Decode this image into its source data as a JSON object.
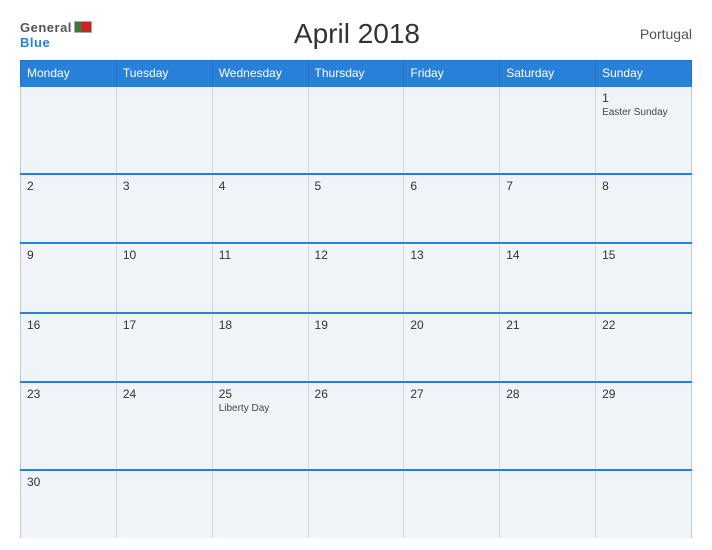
{
  "header": {
    "logo_general": "General",
    "logo_blue": "Blue",
    "title": "April 2018",
    "country": "Portugal"
  },
  "weekdays": [
    "Monday",
    "Tuesday",
    "Wednesday",
    "Thursday",
    "Friday",
    "Saturday",
    "Sunday"
  ],
  "weeks": [
    [
      {
        "day": "",
        "event": ""
      },
      {
        "day": "",
        "event": ""
      },
      {
        "day": "",
        "event": ""
      },
      {
        "day": "",
        "event": ""
      },
      {
        "day": "",
        "event": ""
      },
      {
        "day": "",
        "event": ""
      },
      {
        "day": "1",
        "event": "Easter Sunday"
      }
    ],
    [
      {
        "day": "2",
        "event": ""
      },
      {
        "day": "3",
        "event": ""
      },
      {
        "day": "4",
        "event": ""
      },
      {
        "day": "5",
        "event": ""
      },
      {
        "day": "6",
        "event": ""
      },
      {
        "day": "7",
        "event": ""
      },
      {
        "day": "8",
        "event": ""
      }
    ],
    [
      {
        "day": "9",
        "event": ""
      },
      {
        "day": "10",
        "event": ""
      },
      {
        "day": "11",
        "event": ""
      },
      {
        "day": "12",
        "event": ""
      },
      {
        "day": "13",
        "event": ""
      },
      {
        "day": "14",
        "event": ""
      },
      {
        "day": "15",
        "event": ""
      }
    ],
    [
      {
        "day": "16",
        "event": ""
      },
      {
        "day": "17",
        "event": ""
      },
      {
        "day": "18",
        "event": ""
      },
      {
        "day": "19",
        "event": ""
      },
      {
        "day": "20",
        "event": ""
      },
      {
        "day": "21",
        "event": ""
      },
      {
        "day": "22",
        "event": ""
      }
    ],
    [
      {
        "day": "23",
        "event": ""
      },
      {
        "day": "24",
        "event": ""
      },
      {
        "day": "25",
        "event": "Liberty Day"
      },
      {
        "day": "26",
        "event": ""
      },
      {
        "day": "27",
        "event": ""
      },
      {
        "day": "28",
        "event": ""
      },
      {
        "day": "29",
        "event": ""
      }
    ],
    [
      {
        "day": "30",
        "event": ""
      },
      {
        "day": "",
        "event": ""
      },
      {
        "day": "",
        "event": ""
      },
      {
        "day": "",
        "event": ""
      },
      {
        "day": "",
        "event": ""
      },
      {
        "day": "",
        "event": ""
      },
      {
        "day": "",
        "event": ""
      }
    ]
  ]
}
